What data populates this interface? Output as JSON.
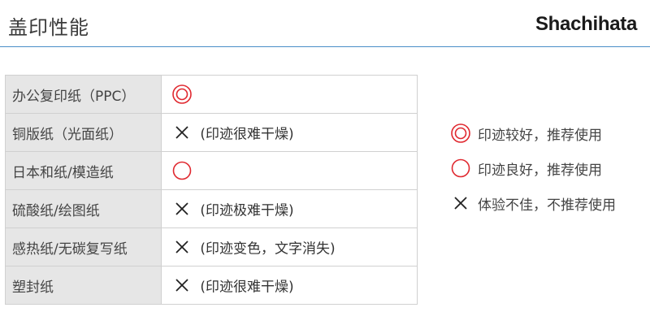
{
  "header": {
    "title": "盖印性能",
    "brand": "Shachihata"
  },
  "colors": {
    "accent_rule": "#4a8ec8",
    "symbol_red": "#e0282f",
    "symbol_dark": "#222222",
    "label_bg": "#e6e6e6"
  },
  "table": {
    "rows": [
      {
        "paper": "办公复印纸（PPC）",
        "symbol": "double-circle-icon",
        "result": ""
      },
      {
        "paper": "铜版纸（光面纸）",
        "symbol": "cross-icon",
        "result": "(印迹很难干燥)"
      },
      {
        "paper": "日本和纸/模造纸",
        "symbol": "circle-icon",
        "result": ""
      },
      {
        "paper": "硫酸纸/绘图纸",
        "symbol": "cross-icon",
        "result": "(印迹极难干燥)"
      },
      {
        "paper": "感热纸/无碳复写纸",
        "symbol": "cross-icon",
        "result": "(印迹变色，文字消失)"
      },
      {
        "paper": "塑封纸",
        "symbol": "cross-icon",
        "result": "(印迹很难干燥)"
      }
    ]
  },
  "legend": {
    "items": [
      {
        "symbol": "double-circle-icon",
        "label": "印迹较好，推荐使用"
      },
      {
        "symbol": "circle-icon",
        "label": "印迹良好，推荐使用"
      },
      {
        "symbol": "cross-icon",
        "label": "体验不佳，不推荐使用"
      }
    ]
  }
}
